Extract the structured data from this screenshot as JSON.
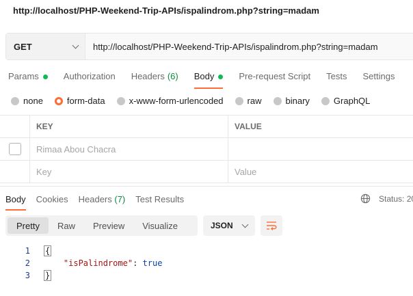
{
  "request": {
    "title": "http://localhost/PHP-Weekend-Trip-APIs/ispalindrom.php?string=madam",
    "method": "GET",
    "url": "http://localhost/PHP-Weekend-Trip-APIs/ispalindrom.php?string=madam"
  },
  "request_tabs": {
    "params": "Params",
    "authorization": "Authorization",
    "headers": "Headers",
    "headers_count": "(6)",
    "body": "Body",
    "prerequest": "Pre-request Script",
    "tests": "Tests",
    "settings": "Settings"
  },
  "body_types": {
    "none": "none",
    "form_data": "form-data",
    "urlencoded": "x-www-form-urlencoded",
    "raw": "raw",
    "binary": "binary",
    "graphql": "GraphQL",
    "selected": "form-data"
  },
  "form_table": {
    "headers": {
      "key": "KEY",
      "value": "VALUE"
    },
    "rows": [
      {
        "key": "Rimaa Abou Chacra",
        "value": ""
      }
    ],
    "placeholder": {
      "key": "Key",
      "value": "Value"
    }
  },
  "response_tabs": {
    "body": "Body",
    "cookies": "Cookies",
    "headers": "Headers",
    "headers_count": "(7)",
    "test_results": "Test Results",
    "status_label": "Status: 20"
  },
  "response_view": {
    "pretty": "Pretty",
    "raw": "Raw",
    "preview": "Preview",
    "visualize": "Visualize",
    "format": "JSON"
  },
  "response_body": {
    "line_numbers": [
      "1",
      "2",
      "3"
    ],
    "open_brace": "{",
    "key": "\"isPalindrome\"",
    "colon": ": ",
    "value": "true",
    "close_brace": "}"
  },
  "colors": {
    "accent": "#ff6c37",
    "success_dot": "#0cbb52",
    "count_green": "#0f8a3e"
  }
}
